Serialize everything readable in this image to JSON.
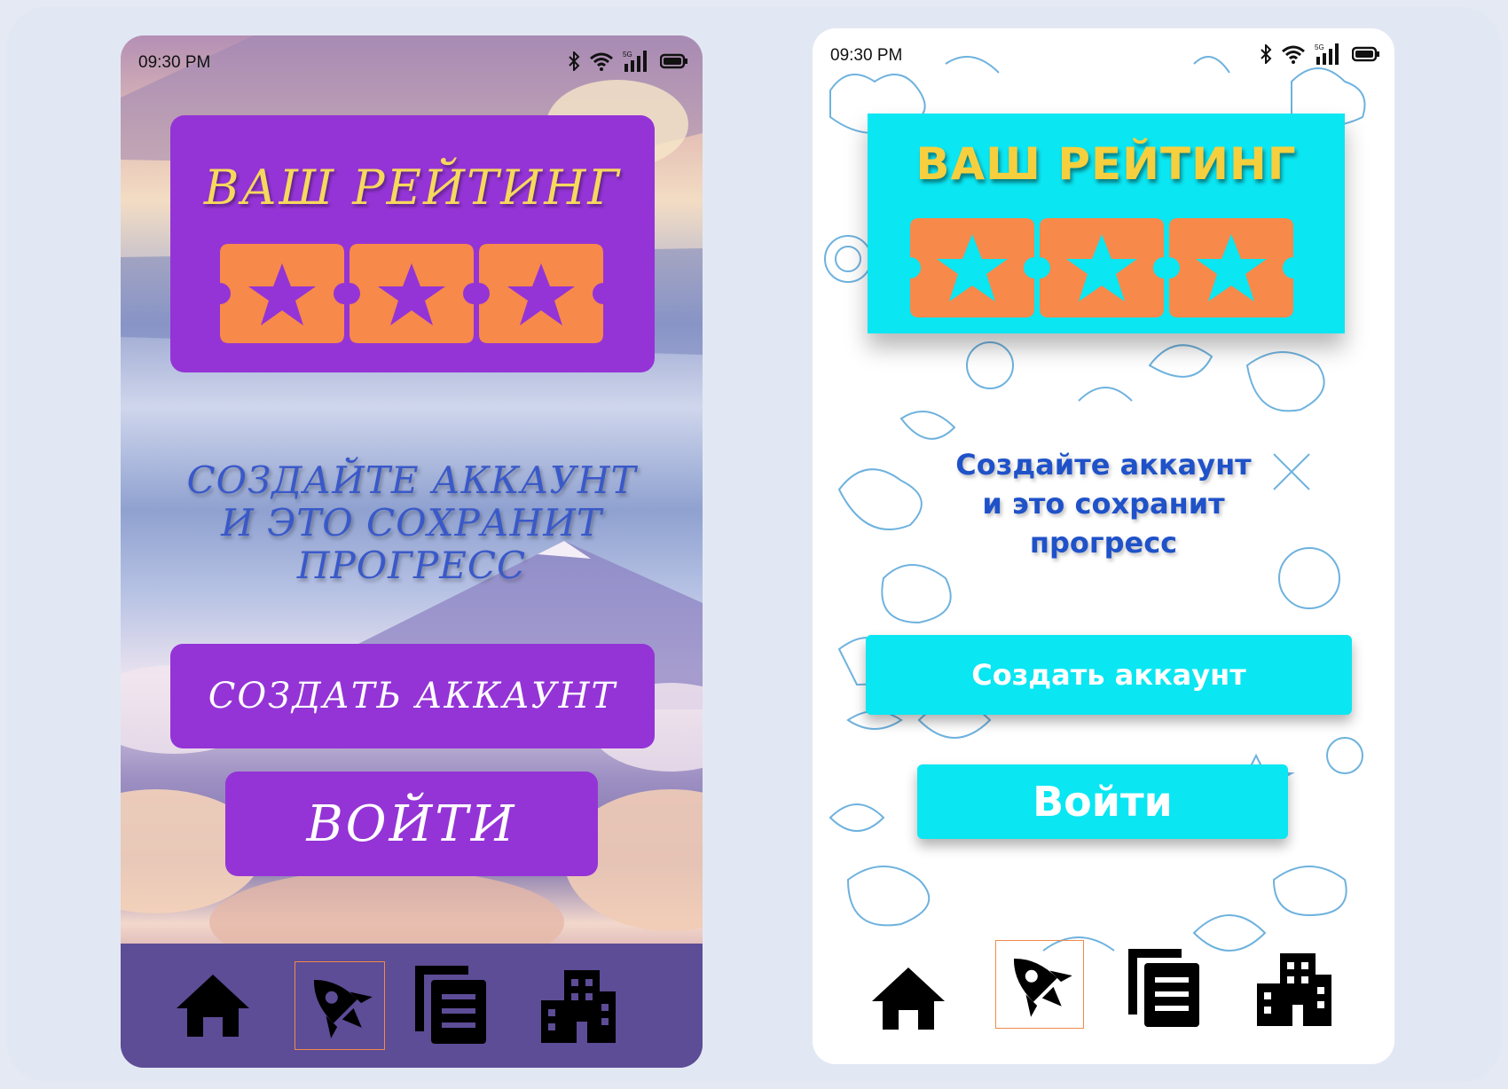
{
  "colors": {
    "left_card": "#9434d6",
    "left_title": "#f6d95c",
    "left_prompt": "#3a59c9",
    "right_card": "#0ae6f2",
    "right_title": "#f6cf3e",
    "right_prompt": "#1f52c9",
    "ticket": "#f7894a",
    "nav_active_border": "#f08a4b"
  },
  "screens": [
    {
      "status": {
        "time": "09:30 PM",
        "icons": [
          "bluetooth-icon",
          "wifi-icon",
          "5g-signal-icon",
          "battery-icon"
        ],
        "network_label": "5G"
      },
      "rating": {
        "title": "ВАШ РЕЙТИНГ",
        "stars": 3
      },
      "prompt_lines": [
        "СОЗДАЙТЕ АККАУНТ",
        "И ЭТО СОХРАНИТ",
        "ПРОГРЕСС"
      ],
      "create_button": "СОЗДАТЬ АККАУНТ",
      "login_button": "ВОЙТИ",
      "nav": {
        "items": [
          "home-icon",
          "rocket-icon",
          "documents-icon",
          "buildings-icon"
        ],
        "active": "rocket-icon"
      }
    },
    {
      "status": {
        "time": "09:30 PM",
        "icons": [
          "bluetooth-icon",
          "wifi-icon",
          "5g-signal-icon",
          "battery-icon"
        ],
        "network_label": "5G"
      },
      "rating": {
        "title": "ВАШ РЕЙТИНГ",
        "stars": 3
      },
      "prompt_lines": [
        "Создайте аккаунт",
        "и это сохранит",
        "прогресс"
      ],
      "create_button": "Создать аккаунт",
      "login_button": "Войти",
      "nav": {
        "items": [
          "home-icon",
          "rocket-icon",
          "documents-icon",
          "buildings-icon"
        ],
        "active": "rocket-icon"
      }
    }
  ]
}
